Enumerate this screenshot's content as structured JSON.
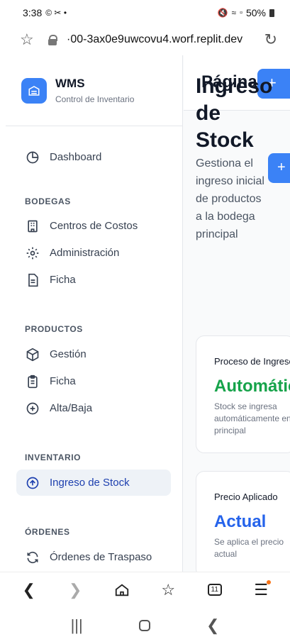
{
  "status": {
    "time": "3:38",
    "left_icons": "© ✂ •",
    "battery": "50%"
  },
  "browser": {
    "url": "·00-3ax0e9uwcovu4.worf.replit.dev"
  },
  "brand": {
    "title": "WMS",
    "subtitle": "Control de Inventario"
  },
  "sidebar": {
    "dashboard": "Dashboard",
    "sections": [
      {
        "title": "BODEGAS",
        "items": [
          "Centros de Costos",
          "Administración",
          "Ficha"
        ]
      },
      {
        "title": "PRODUCTOS",
        "items": [
          "Gestión",
          "Ficha",
          "Alta/Baja"
        ]
      },
      {
        "title": "INVENTARIO",
        "items": [
          "Ingreso de Stock"
        ]
      },
      {
        "title": "ÓRDENES",
        "items": [
          "Órdenes de Traspaso"
        ]
      }
    ]
  },
  "topbar": {
    "title": "Página",
    "button": "+"
  },
  "main": {
    "title": "Ingreso de Stock",
    "description": "Gestiona el ingreso inicial de productos a la bodega principal",
    "button": "+"
  },
  "cards": [
    {
      "label": "Proceso de Ingreso",
      "value": "Automático",
      "value_color": "#16a34a",
      "note_lines": [
        "Stock se ingresa",
        "automáticamente en la bodega",
        "principal"
      ]
    },
    {
      "label": "Precio Aplicado",
      "value": "Actual",
      "value_color": "#2563eb",
      "note_lines": [
        "Se aplica el precio",
        "actual"
      ]
    }
  ],
  "colors": {
    "accent": "#3b82f6",
    "active_bg": "#eef2f7",
    "active_text": "#1e40af"
  },
  "icons": {
    "browser_nav": [
      "back-icon",
      "forward-icon",
      "home-icon",
      "bookmarks-icon",
      "tabs-icon",
      "menu-icon"
    ],
    "tabs_count": "11"
  }
}
